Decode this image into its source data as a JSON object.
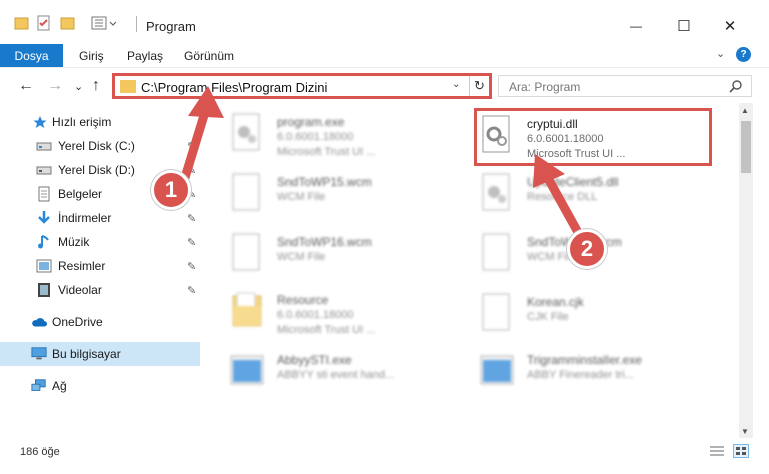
{
  "window": {
    "title": "Program",
    "minimize": "—",
    "maximize": "☐",
    "close": "✕"
  },
  "ribbon": {
    "file_tab": "Dosya",
    "tabs": [
      "Giriş",
      "Paylaş",
      "Görünüm"
    ],
    "expand": "⌄",
    "help": "?"
  },
  "address": {
    "path": "C:\\Program Files\\Program Dizini",
    "dropdown": "⌄",
    "refresh": "↻"
  },
  "search": {
    "placeholder": "Ara: Program"
  },
  "nav": {
    "back": "←",
    "forward": "→",
    "recent": "⌄",
    "up": "↑"
  },
  "sidebar": {
    "items": [
      {
        "label": "Hızlı erişim",
        "icon": "star-icon",
        "pinned": false
      },
      {
        "label": "Yerel Disk (C:)",
        "icon": "drive-icon",
        "pinned": true
      },
      {
        "label": "Yerel Disk (D:)",
        "icon": "drive-icon",
        "pinned": true
      },
      {
        "label": "Belgeler",
        "icon": "documents-icon",
        "pinned": true
      },
      {
        "label": "İndirmeler",
        "icon": "download-icon",
        "pinned": true
      },
      {
        "label": "Müzik",
        "icon": "music-icon",
        "pinned": true
      },
      {
        "label": "Resimler",
        "icon": "pictures-icon",
        "pinned": true
      },
      {
        "label": "Videolar",
        "icon": "videos-icon",
        "pinned": true
      },
      {
        "label": "OneDrive",
        "icon": "cloud-icon",
        "pinned": false
      },
      {
        "label": "Bu bilgisayar",
        "icon": "computer-icon",
        "pinned": false
      },
      {
        "label": "Ağ",
        "icon": "network-icon",
        "pinned": false
      }
    ],
    "pin_glyph": "📌"
  },
  "files": [
    {
      "name": "program.exe",
      "line1": "6.0.6001.18000",
      "line2": "Microsoft Trust UI ...",
      "icon": "gear-file-icon"
    },
    {
      "name": "cryptui.dll",
      "line1": "6.0.6001.18000",
      "line2": "Microsoft Trust UI ...",
      "icon": "gear-file-icon"
    },
    {
      "name": "SndToWP15.wcm",
      "line1": "WCM File",
      "line2": "",
      "icon": "blank-file-icon"
    },
    {
      "name": "UpdateClient5.dll",
      "line1": "Resource DLL",
      "line2": "",
      "icon": "gear-file-icon"
    },
    {
      "name": "SndToWP16.wcm",
      "line1": "WCM File",
      "line2": "",
      "icon": "blank-file-icon"
    },
    {
      "name": "SndToWP16.wcm",
      "line1": "WCM File",
      "line2": "",
      "icon": "blank-file-icon"
    },
    {
      "name": "Resource",
      "line1": "6.0.6001.18000",
      "line2": "Microsoft Trust UI ...",
      "icon": "folder-icon"
    },
    {
      "name": "Korean.cjk",
      "line1": "CJK File",
      "line2": "",
      "icon": "blank-file-icon"
    },
    {
      "name": "AbbyySTI.exe",
      "line1": "ABBYY sti event hand...",
      "line2": "",
      "icon": "app-icon"
    },
    {
      "name": "TrigramminstalIer.exe",
      "line1": "ABBY Finereader tri...",
      "line2": "",
      "icon": "app-icon"
    }
  ],
  "status": {
    "count": "186 öğe"
  },
  "annotations": {
    "badge1": "1",
    "badge2": "2"
  },
  "colors": {
    "accent": "#1979ca",
    "highlight": "#d9534f",
    "selected": "#cde6f7",
    "folder": "#f3c75d"
  }
}
